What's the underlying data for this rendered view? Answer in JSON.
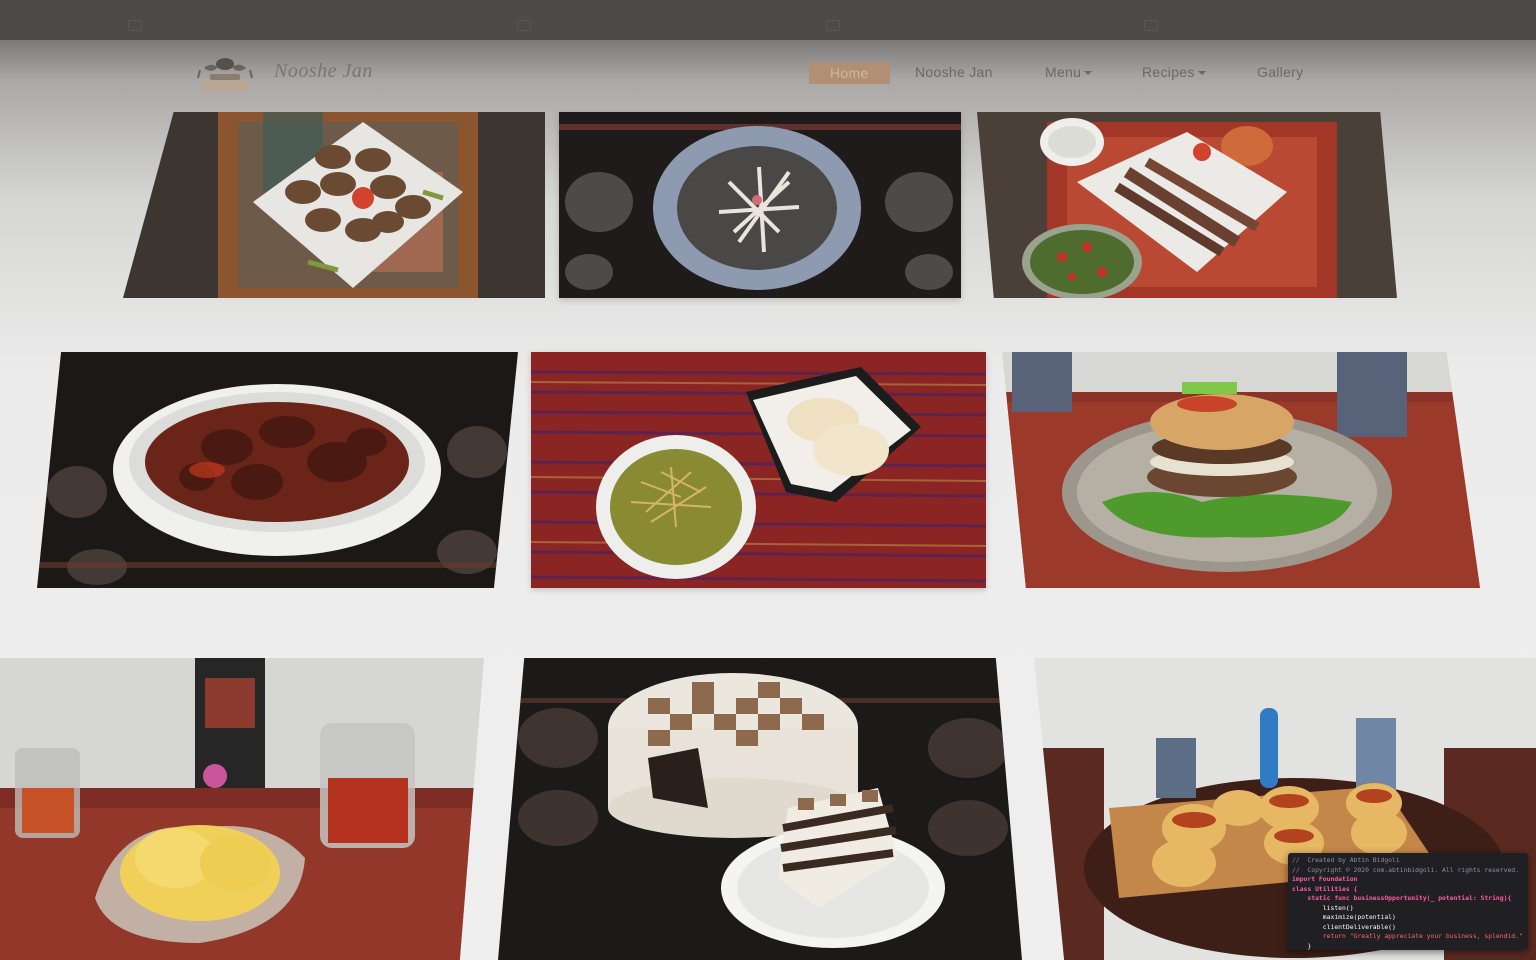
{
  "nav": {
    "brand": "Nooshe Jan",
    "links": [
      {
        "label": "Home",
        "active": true
      },
      {
        "label": "Nooshe Jan"
      },
      {
        "label": "Menu",
        "dropdown": true
      },
      {
        "label": "Recipes",
        "dropdown": true
      },
      {
        "label": "Gallery"
      }
    ]
  },
  "gallery": {
    "photos": [
      {
        "name": "meat-patties-plate"
      },
      {
        "name": "dark-soup-bowl"
      },
      {
        "name": "kebab-plate-with-salad"
      },
      {
        "name": "stew-casserole"
      },
      {
        "name": "green-soup-with-bread"
      },
      {
        "name": "burger-on-tray"
      },
      {
        "name": "saffron-ice-cream"
      },
      {
        "name": "checkered-cake"
      },
      {
        "name": "pastry-rolls-board"
      }
    ]
  },
  "code_window": {
    "lines": [
      "//  Created by Abtin Bidgoli",
      "//  Copyright © 2020 com.abtinbidgoli. All rights reserved.",
      "import Foundation",
      "class Utilities {",
      "    static func businessOpportunity(_ potential: String){",
      "        listen()",
      "        maximize(potential)",
      "        clientDeliverable()",
      "        return \"Greatly appreciate your business, splendid.\"",
      "    }"
    ]
  },
  "colors": {
    "topbar": "#4d4a49",
    "nav_active": "#b18f74",
    "brand": "#807468"
  }
}
